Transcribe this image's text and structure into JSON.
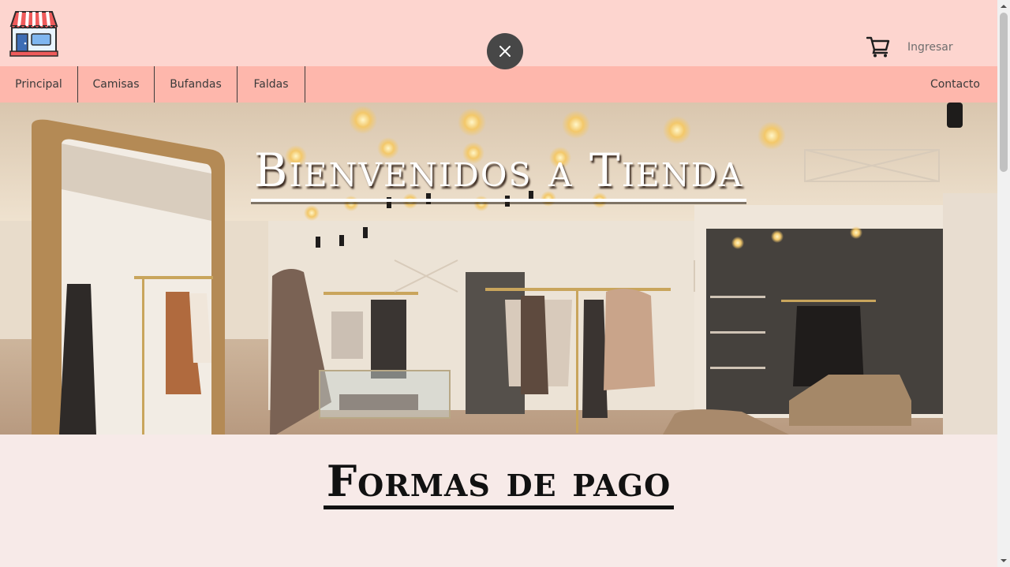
{
  "header": {
    "logo_icon": "store-icon",
    "close_icon": "close-icon",
    "cart_icon": "shopping-cart-icon",
    "login_label": "Ingresar"
  },
  "nav": {
    "items": [
      {
        "label": "Principal"
      },
      {
        "label": "Camisas"
      },
      {
        "label": "Bufandas"
      },
      {
        "label": "Faldas"
      }
    ],
    "contact_label": "Contacto"
  },
  "hero": {
    "title": "Bienvenidos a Tienda",
    "image": "clothing-store-interior"
  },
  "section": {
    "title": "Formas de pago"
  },
  "colors": {
    "topbar": "#fdd5cf",
    "navbar": "#feb7ac",
    "body": "#f7eae8",
    "close_button": "#474747"
  }
}
